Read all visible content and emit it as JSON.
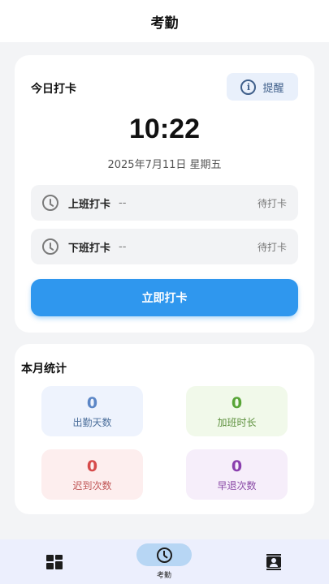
{
  "header": {
    "title": "考勤"
  },
  "today": {
    "title": "今日打卡",
    "remind_label": "提醒",
    "time": "10:22",
    "date": "2025年7月11日 星期五",
    "clock_in": {
      "label": "上班打卡",
      "time": "--",
      "status": "待打卡"
    },
    "clock_out": {
      "label": "下班打卡",
      "time": "--",
      "status": "待打卡"
    },
    "punch_button": "立即打卡"
  },
  "month": {
    "title": "本月统计",
    "stats": [
      {
        "value": "0",
        "label": "出勤天数"
      },
      {
        "value": "0",
        "label": "加班时长"
      },
      {
        "value": "0",
        "label": "迟到次数"
      },
      {
        "value": "0",
        "label": "早退次数"
      }
    ]
  },
  "nav": {
    "items": [
      {
        "label": "",
        "icon": "dashboard-icon"
      },
      {
        "label": "考勤",
        "icon": "clock-icon",
        "active": true
      },
      {
        "label": "",
        "icon": "contacts-icon"
      }
    ]
  },
  "colors": {
    "primary": "#2f97ee",
    "nav_active": "#b7d6f4",
    "background": "#f3f4f6"
  }
}
